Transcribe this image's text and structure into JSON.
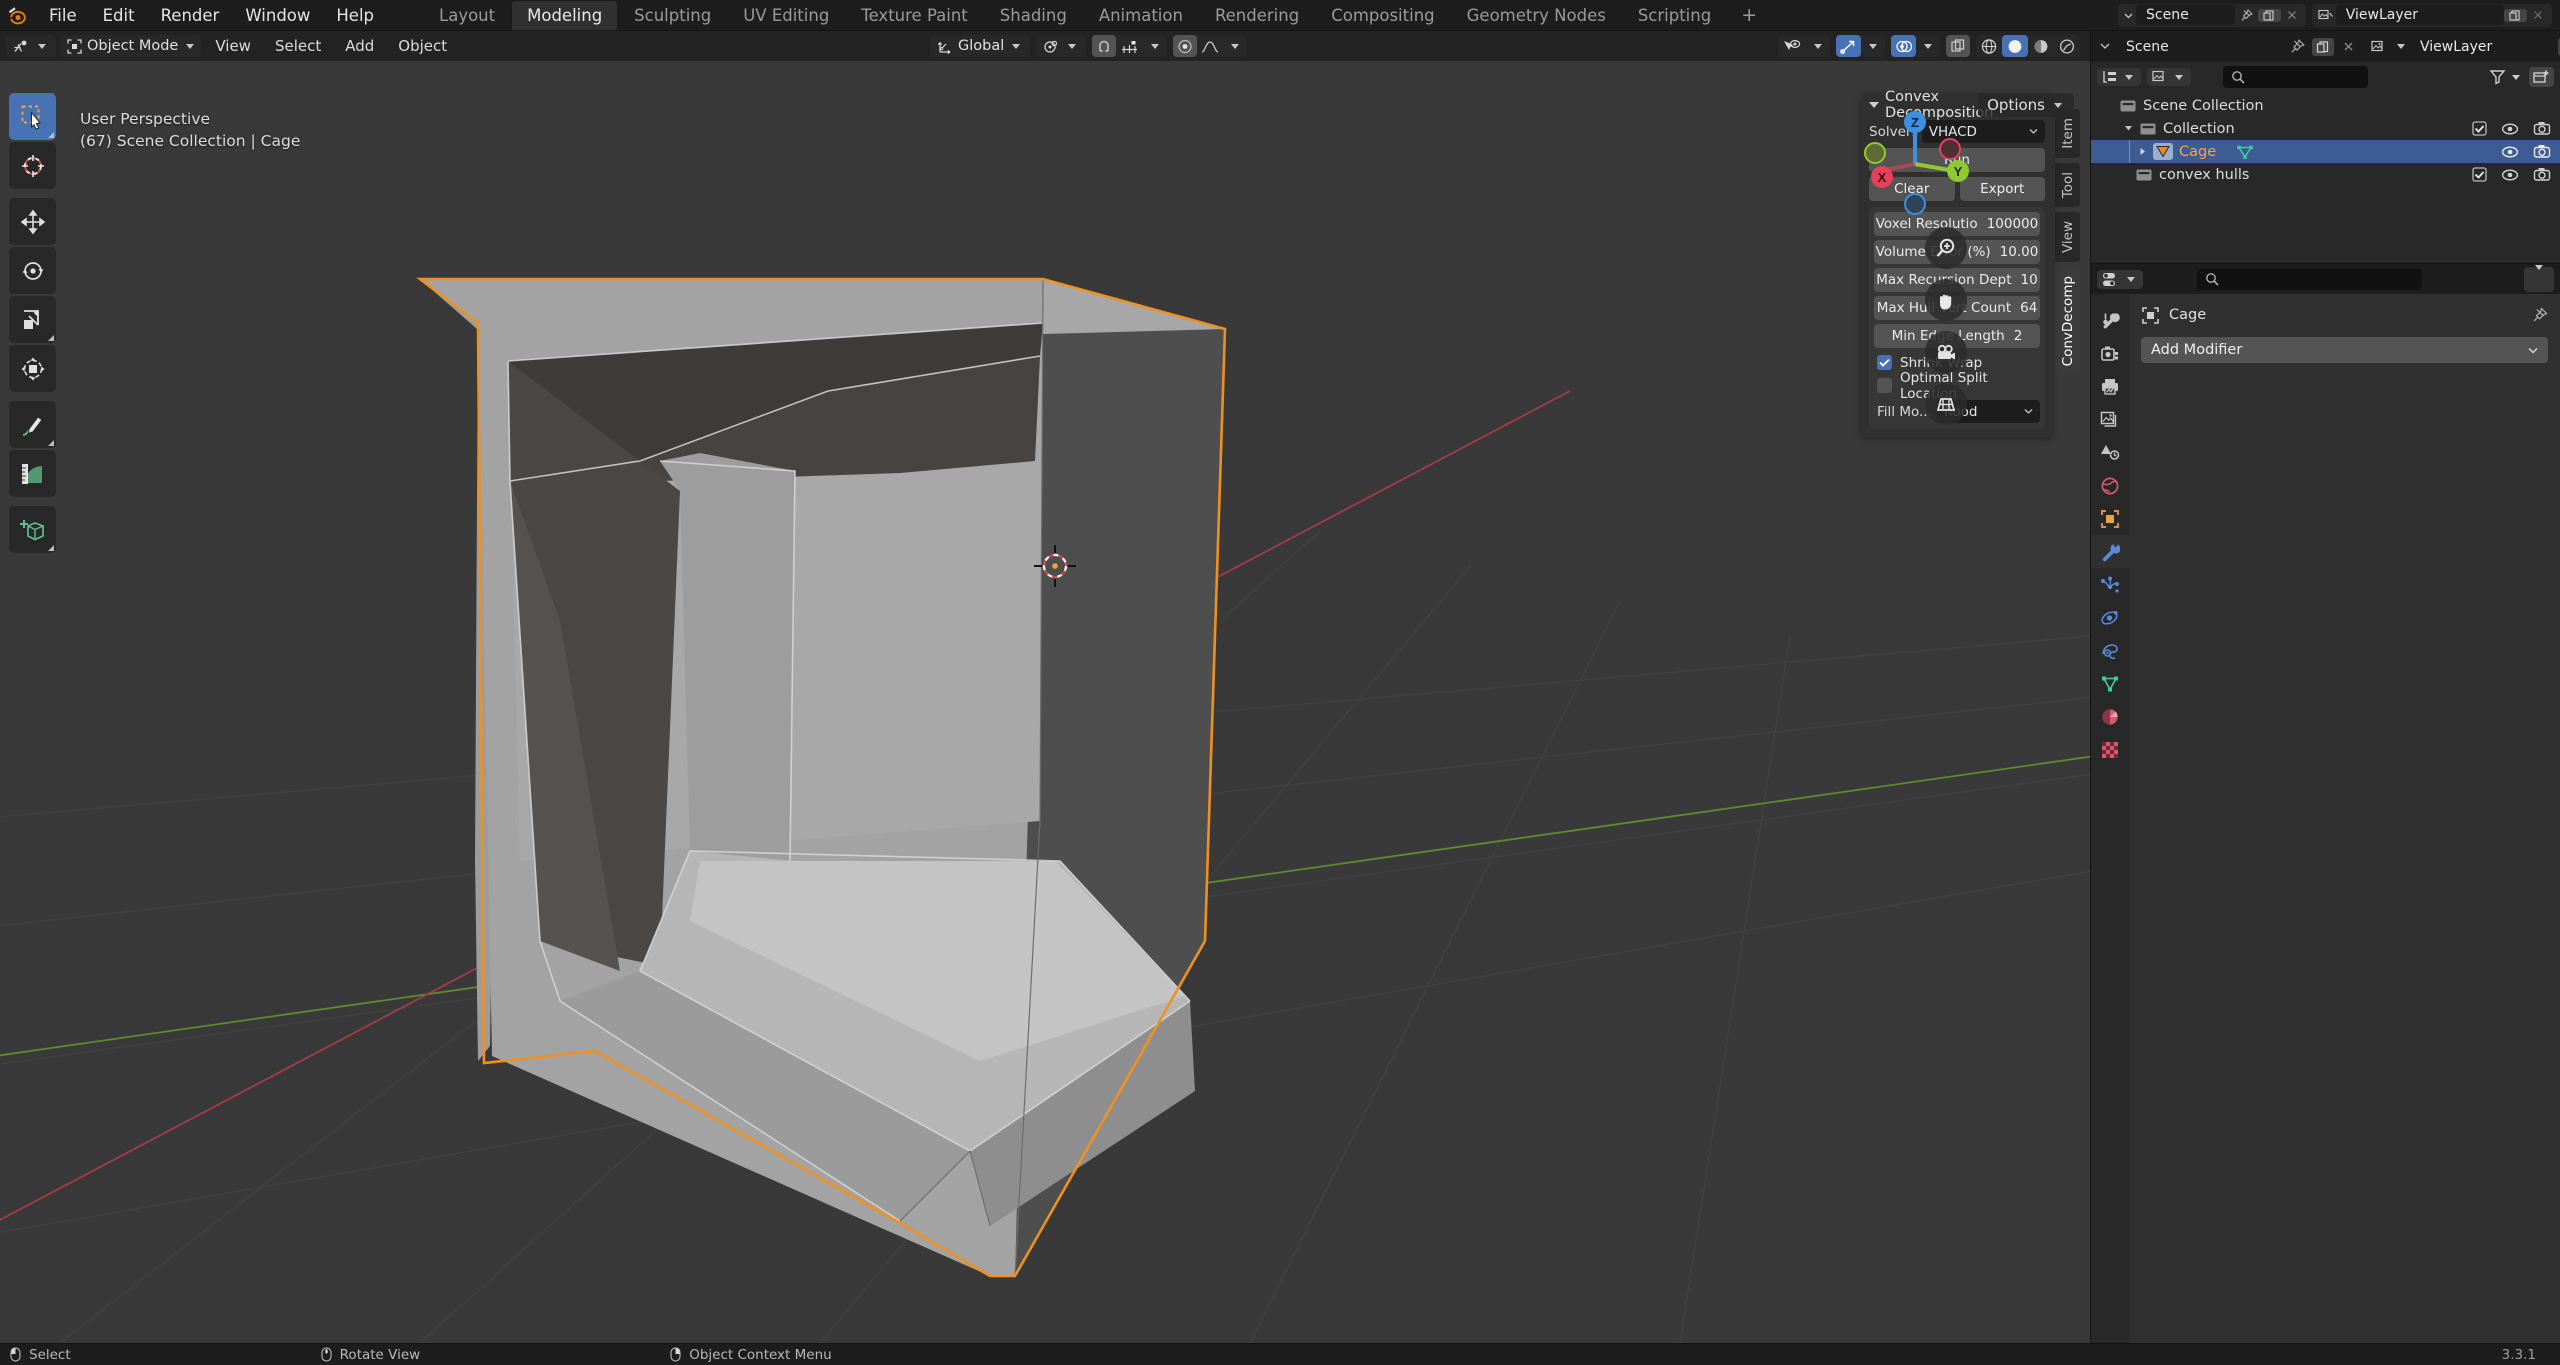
{
  "app": {
    "version": "3.3.1",
    "accent_blue": "#4772b3",
    "accent_orange": "#ed9123",
    "bg_dark": "#1d1d1d",
    "bg_panel": "#303030",
    "bg_viewport": "#393939"
  },
  "topbar": {
    "logo_icon": "blender-logo-icon",
    "menus": [
      {
        "label": "File"
      },
      {
        "label": "Edit"
      },
      {
        "label": "Render"
      },
      {
        "label": "Window"
      },
      {
        "label": "Help"
      }
    ],
    "workspace_tabs": [
      {
        "label": "Layout",
        "active": false
      },
      {
        "label": "Modeling",
        "active": true
      },
      {
        "label": "Sculpting",
        "active": false
      },
      {
        "label": "UV Editing",
        "active": false
      },
      {
        "label": "Texture Paint",
        "active": false
      },
      {
        "label": "Shading",
        "active": false
      },
      {
        "label": "Animation",
        "active": false
      },
      {
        "label": "Rendering",
        "active": false
      },
      {
        "label": "Compositing",
        "active": false
      },
      {
        "label": "Geometry Nodes",
        "active": false
      },
      {
        "label": "Scripting",
        "active": false
      }
    ],
    "add_workspace_label": "+",
    "scene_field": {
      "icon": "scene-icon",
      "value": "Scene"
    },
    "viewlayer_field": {
      "icon": "viewlayer-icon",
      "value": "ViewLayer"
    }
  },
  "viewport": {
    "header": {
      "mode_selector": {
        "icon": "editor-type-icon",
        "label": "Object Mode"
      },
      "menus": [
        {
          "label": "View"
        },
        {
          "label": "Select"
        },
        {
          "label": "Add"
        },
        {
          "label": "Object"
        }
      ],
      "transform_orientation": {
        "icon": "orientation-icon",
        "label": "Global"
      },
      "pivot_point": {
        "icon": "pivot-icon"
      },
      "snap_magnet": {
        "icon": "snap-magnet-icon",
        "active": false
      },
      "snap_to": {
        "icon": "snap-increment-icon"
      },
      "proportional_edit": {
        "icon": "proportional-icon",
        "active": false
      },
      "falloff": {
        "icon": "falloff-curve-icon"
      },
      "visibility_selectability": {
        "icon": "object-visibility-icon"
      },
      "show_gizmo": {
        "icon": "gizmo-icon",
        "active": true
      },
      "show_overlays": {
        "icon": "overlays-icon",
        "active": true
      },
      "xray_toggle": {
        "icon": "xray-icon",
        "active": false
      },
      "shading_modes": [
        {
          "icon": "wireframe-shading-icon",
          "active": false
        },
        {
          "icon": "solid-shading-icon",
          "active": true
        },
        {
          "icon": "material-preview-shading-icon",
          "active": false
        },
        {
          "icon": "rendered-shading-icon",
          "active": false
        }
      ]
    },
    "overlay_text": {
      "line1": "User Perspective",
      "line2": "(67) Scene Collection | Cage"
    },
    "options_button": {
      "label": "Options",
      "icon": "chevron-down-icon"
    },
    "toolbar": [
      {
        "name": "tweak-select-tool",
        "icon": "select-box-tool-icon",
        "active": true
      },
      {
        "name": "cursor-tool",
        "icon": "cursor-3d-tool-icon",
        "active": false
      },
      {
        "name": "move-tool",
        "icon": "move-tool-icon",
        "active": false
      },
      {
        "name": "rotate-tool",
        "icon": "rotate-tool-icon",
        "active": false
      },
      {
        "name": "scale-tool",
        "icon": "scale-tool-icon",
        "active": false
      },
      {
        "name": "transform-tool",
        "icon": "transform-tool-icon",
        "active": false
      },
      {
        "name": "annotate-tool",
        "icon": "annotate-tool-icon",
        "active": false
      },
      {
        "name": "measure-tool",
        "icon": "measure-tool-icon",
        "active": false
      },
      {
        "name": "add-cube-tool",
        "icon": "add-cube-tool-icon",
        "active": false
      }
    ],
    "gizmo": {
      "axes": [
        {
          "label": "Z",
          "color": "#3d8fe0",
          "positive": true
        },
        {
          "label": "Y",
          "color": "#8fc931",
          "positive": true
        },
        {
          "label": "X",
          "color": "#e5415a",
          "positive": true
        }
      ],
      "nav_buttons": [
        {
          "name": "zoom-nav-button",
          "icon": "zoom-magnifier-icon"
        },
        {
          "name": "pan-nav-button",
          "icon": "hand-pan-icon"
        },
        {
          "name": "camera-view-button",
          "icon": "camera-icon"
        },
        {
          "name": "toggle-ortho-button",
          "icon": "perspective-grid-icon"
        }
      ]
    },
    "scene": {
      "object_name": "Cage",
      "selection_outline_color": "#ed9123",
      "cursor_3d": true,
      "grid_floor": true,
      "axis_x_color": "#a33b4b",
      "axis_y_color": "#5c8a2e"
    }
  },
  "npanel": {
    "tabs": [
      {
        "label": "Item",
        "active": false
      },
      {
        "label": "Tool",
        "active": false
      },
      {
        "label": "View",
        "active": false
      },
      {
        "label": "ConvDecomp",
        "active": true
      }
    ],
    "panel": {
      "title": "Convex Decomposition",
      "collapse_icon": "triangle-down-icon",
      "grip_icon": "panel-grip-icon",
      "solver_label": "Solver:",
      "solver_value": "VHACD",
      "run_label": "Run",
      "clear_label": "Clear",
      "export_label": "Export",
      "properties": [
        {
          "name": "Voxel Resolutio",
          "value": "100000"
        },
        {
          "name": "Volume Error (%)",
          "value": "10.00"
        },
        {
          "name": "Max Recursion Dept",
          "value": "10"
        },
        {
          "name": "Max Hull Vert Count",
          "value": "64"
        },
        {
          "name": "Min Edge Length",
          "value": "2"
        }
      ],
      "checkboxes": [
        {
          "label": "Shrink Wrap",
          "checked": true
        },
        {
          "label": "Optimal Split Location",
          "checked": false
        }
      ],
      "fill_mode_label": "Fill Mo...",
      "fill_mode_value": "flood"
    }
  },
  "outliner": {
    "header": {
      "editor_icon": "outliner-editor-icon",
      "scene_label": "Scene",
      "pin_icon": "pin-icon",
      "copy_icon": "new-scene-icon",
      "delete_icon": "x-icon",
      "viewlayer_icon": "viewlayer-icon",
      "viewlayer_label": "ViewLayer"
    },
    "toolrow": {
      "display_mode_icon": "outliner-display-mode-icon",
      "filter_id_icon": "id-type-filter-icon",
      "search_placeholder": "",
      "search_icon": "search-icon",
      "filter_icon": "funnel-filter-icon",
      "new_collection_icon": "new-collection-icon"
    },
    "tree": [
      {
        "label": "Scene Collection",
        "icon": "collection-icon",
        "indent": 0,
        "expanded": true,
        "selected": false,
        "has_disclosure": false,
        "toggles": []
      },
      {
        "label": "Collection",
        "icon": "collection-icon",
        "indent": 1,
        "expanded": true,
        "selected": false,
        "has_disclosure": true,
        "toggles": [
          "checkbox-checked",
          "eye-icon",
          "camera-icon"
        ]
      },
      {
        "label": "Cage",
        "icon": "mesh-object-icon",
        "data_icon": "mesh-data-icon",
        "indent": 2,
        "expanded": false,
        "selected": true,
        "has_disclosure": true,
        "toggles": [
          "eye-icon",
          "camera-icon"
        ]
      },
      {
        "label": "convex hulls",
        "icon": "collection-icon",
        "indent": 1,
        "expanded": false,
        "selected": false,
        "has_disclosure": false,
        "toggles": [
          "checkbox-checked",
          "eye-icon",
          "camera-icon"
        ]
      }
    ]
  },
  "properties": {
    "header": {
      "editor_icon": "properties-editor-icon",
      "search_placeholder": "",
      "search_icon": "search-icon",
      "options_icon": "chevron-down-icon"
    },
    "tabs": [
      {
        "name": "tool-tab",
        "icon": "tool-icon",
        "active": false
      },
      {
        "name": "render-tab",
        "icon": "render-camera-icon",
        "active": false
      },
      {
        "name": "output-tab",
        "icon": "printer-output-icon",
        "active": false
      },
      {
        "name": "view-layer-tab",
        "icon": "images-viewlayer-icon",
        "active": false
      },
      {
        "name": "scene-tab",
        "icon": "scene-cone-icon",
        "active": false
      },
      {
        "name": "world-tab",
        "icon": "world-globe-icon",
        "active": false
      },
      {
        "name": "object-tab",
        "icon": "object-square-icon",
        "active": false
      },
      {
        "name": "modifier-tab",
        "icon": "wrench-icon",
        "active": true
      },
      {
        "name": "particles-tab",
        "icon": "particles-icon",
        "active": false
      },
      {
        "name": "physics-tab",
        "icon": "physics-orbit-icon",
        "active": false
      },
      {
        "name": "constraints-tab",
        "icon": "constraint-icon",
        "active": false
      },
      {
        "name": "data-tab",
        "icon": "mesh-data-icon",
        "active": false
      },
      {
        "name": "material-tab",
        "icon": "material-sphere-icon",
        "active": false
      },
      {
        "name": "texture-tab",
        "icon": "texture-checker-icon",
        "active": false
      }
    ],
    "breadcrumb": {
      "object_icon": "object-square-icon",
      "object_name": "Cage",
      "pin_icon": "pin-icon"
    },
    "add_modifier_label": "Add Modifier",
    "add_modifier_chevron": "chevron-down-icon"
  },
  "statusbar": {
    "items": [
      {
        "icon": "mouse-left-icon",
        "label": "Select"
      },
      {
        "icon": "mouse-middle-icon",
        "label": "Rotate View"
      },
      {
        "icon": "mouse-right-icon",
        "label": "Object Context Menu"
      }
    ],
    "version": "3.3.1"
  }
}
